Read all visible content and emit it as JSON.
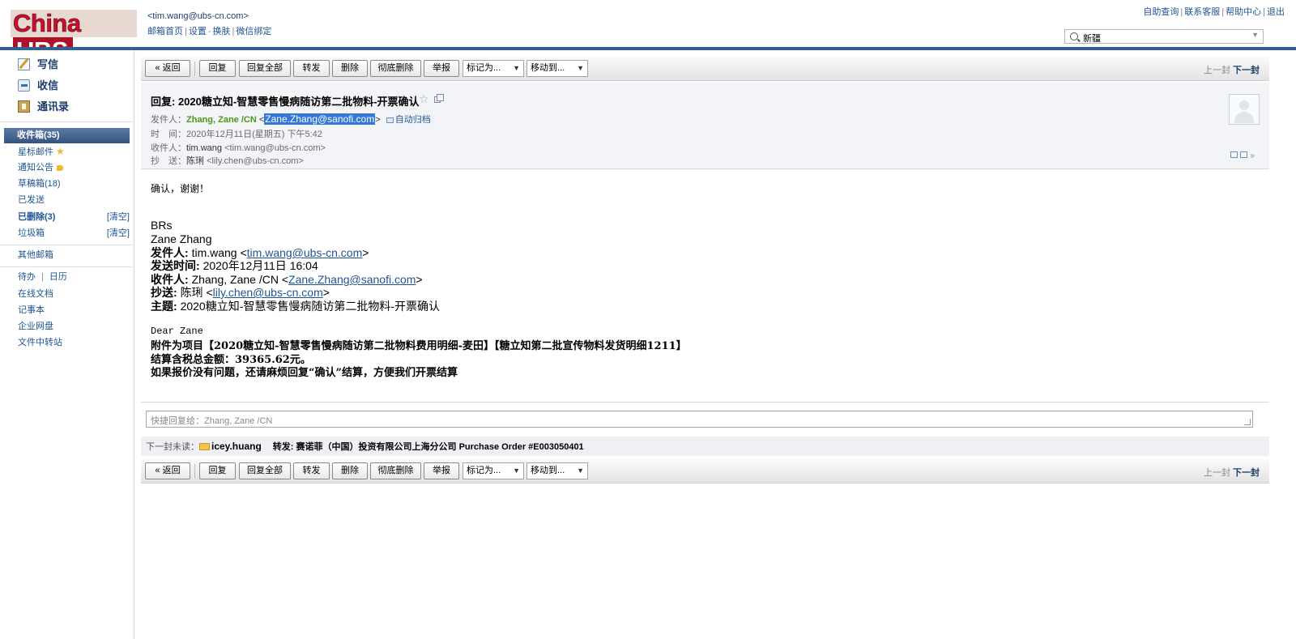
{
  "header": {
    "logo": {
      "left": "China",
      "right": "UBS"
    },
    "user_email": "<tim.wang@ubs-cn.com>",
    "top_links": [
      "邮箱首页",
      "设置",
      "换肤",
      "微信绑定"
    ],
    "right_links": [
      "自助查询",
      "联系客服",
      "帮助中心",
      "退出"
    ],
    "search_value": "新疆"
  },
  "sidebar": {
    "actions": [
      "写信",
      "收信",
      "通讯录"
    ],
    "inbox": "收件箱(35)",
    "folders": [
      {
        "label": "星标邮件"
      },
      {
        "label": "通知公告"
      },
      {
        "label": "草稿箱(18)"
      },
      {
        "label": "已发送"
      },
      {
        "label": "已删除(3)",
        "clear": "[清空]"
      },
      {
        "label": "垃圾箱",
        "clear": "[清空]"
      }
    ],
    "other_mail": "其他邮箱",
    "tools": {
      "todo": "待办",
      "sep": "|",
      "calendar": "日历"
    },
    "apps": [
      "在线文档",
      "记事本",
      "企业网盘",
      "文件中转站"
    ]
  },
  "toolbar": {
    "back": "« 返回",
    "reply": "回复",
    "reply_all": "回复全部",
    "forward": "转发",
    "delete": "删除",
    "delete_perm": "彻底删除",
    "report": "举报",
    "mark_as": "标记为...",
    "move_to": "移动到...",
    "prev": "上一封",
    "next": "下一封"
  },
  "mail": {
    "subject": "回复: 2020糖立知-智慧零售慢病随访第二批物料-开票确认",
    "from_label": "发件人：",
    "from_name": "Zhang, Zane /CN",
    "from_email": "Zane.Zhang@sanofi.com",
    "archive": "自动归档",
    "time_label": "时　间：",
    "time_value": "2020年12月11日(星期五) 下午5:42",
    "to_label": "收件人：",
    "to_name": "tim.wang",
    "to_email": "<tim.wang@ubs-cn.com>",
    "cc_label": "抄　送：",
    "cc_name": "陈琍",
    "cc_email": "<lily.chen@ubs-cn.com>"
  },
  "body": {
    "greeting": "确认，谢谢！",
    "sig1": "BRs",
    "sig2": "Zane Zhang",
    "q_from_label": "发件人:",
    "q_from_name": "tim.wang <",
    "q_from_email": "tim.wang@ubs-cn.com",
    "q_time_label": "发送时间:",
    "q_time": "2020年12月11日 16:04",
    "q_to_label": "收件人:",
    "q_to_name": "Zhang, Zane /CN <",
    "q_to_email": "Zane.Zhang@sanofi.com",
    "q_cc_label": "抄送:",
    "q_cc_name": "陈琍 <",
    "q_cc_email": "lily.chen@ubs-cn.com",
    "q_subj_label": "主题:",
    "q_subj": "2020糖立知-智慧零售慢病随访第二批物料-开票确认",
    "dear": "Dear Zane",
    "line1": "附件为项目【2020糖立知-智慧零售慢病随访第二批物料费用明细-麦田】【糖立知第二批宣传物料发货明细1211】",
    "line2": "结算含税总金额：39365.62元。",
    "line3": "如果报价没有问题，还请麻烦回复“确认”结算，方便我们开票结算"
  },
  "quick_reply": {
    "placeholder": "快捷回复给：Zhang, Zane /CN"
  },
  "next_unread": {
    "label": "下一封未读：",
    "from": "icey.huang",
    "subject": "转发: 赛诺菲（中国）投资有限公司上海分公司 Purchase Order #E003050401"
  }
}
